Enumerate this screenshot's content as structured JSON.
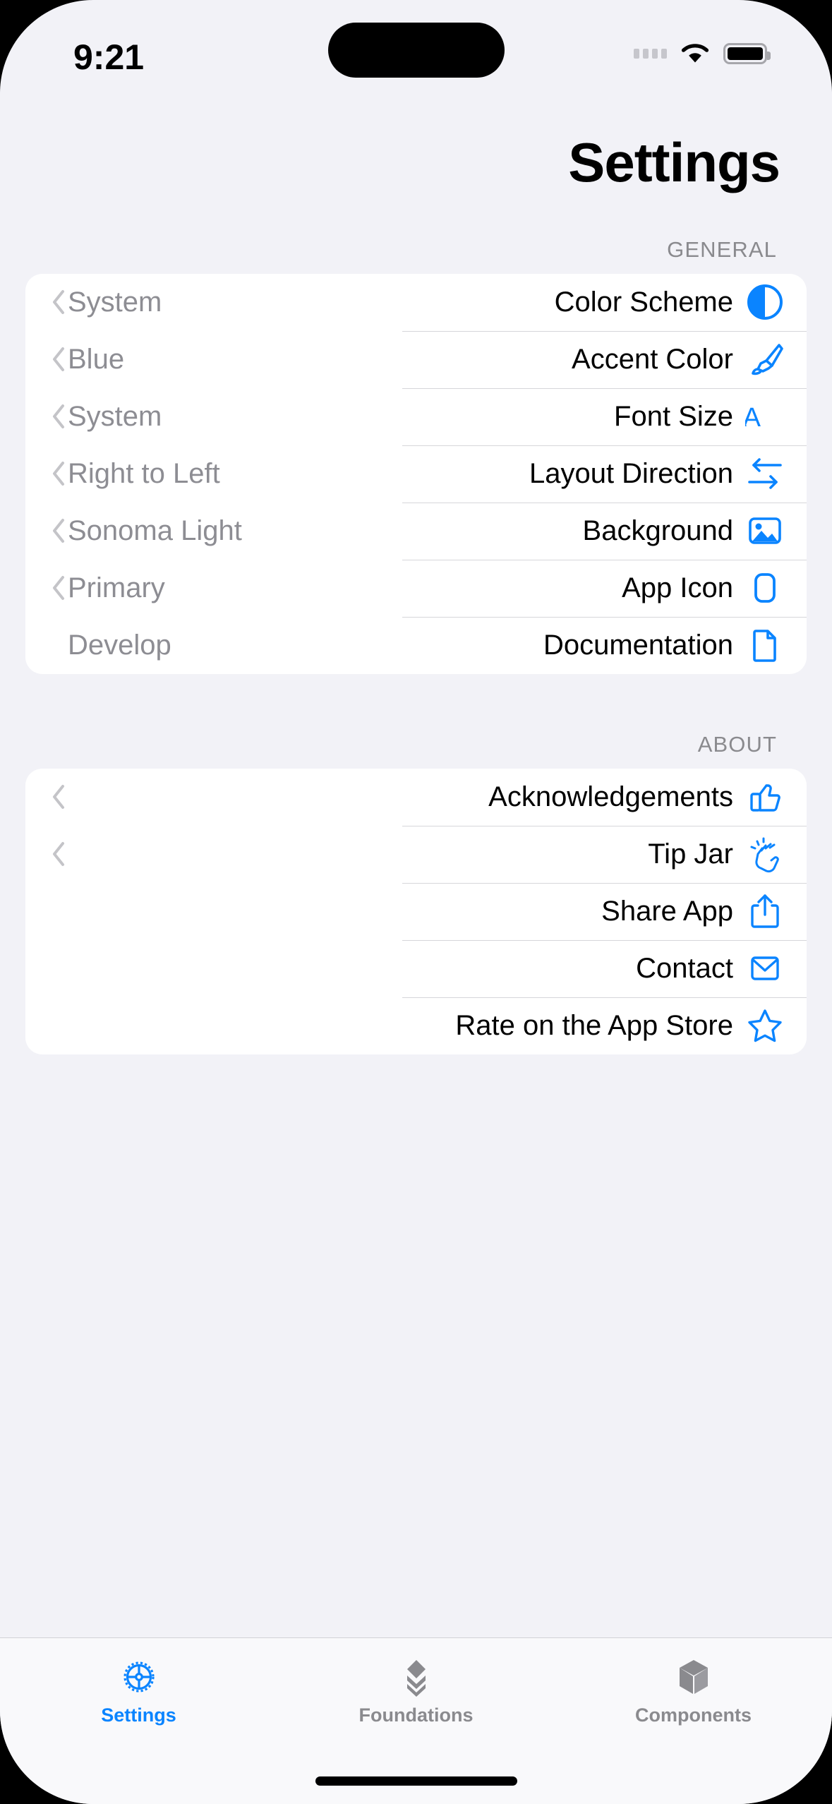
{
  "status_bar": {
    "time": "9:21",
    "signal_icon": "signal-dots-icon",
    "wifi_icon": "wifi-icon",
    "battery_icon": "battery-icon"
  },
  "header": {
    "title": "Settings"
  },
  "sections": [
    {
      "header": "GENERAL",
      "rows": [
        {
          "title": "Color Scheme",
          "value": "System",
          "icon": "circle-half-filled-icon",
          "has_chevron": true
        },
        {
          "title": "Accent Color",
          "value": "Blue",
          "icon": "paintbrush-icon",
          "has_chevron": true
        },
        {
          "title": "Font Size",
          "value": "System",
          "icon": "text-size-aa-icon",
          "has_chevron": true
        },
        {
          "title": "Layout Direction",
          "value": "Right to Left",
          "icon": "arrows-left-right-icon",
          "has_chevron": true
        },
        {
          "title": "Background",
          "value": "Sonoma Light",
          "icon": "photo-icon",
          "has_chevron": true
        },
        {
          "title": "App Icon",
          "value": "Primary",
          "icon": "app-icon-rounded-rect",
          "has_chevron": true
        },
        {
          "title": "Documentation",
          "value": "Develop",
          "icon": "document-icon",
          "has_chevron": false
        }
      ]
    },
    {
      "header": "ABOUT",
      "rows": [
        {
          "title": "Acknowledgements",
          "value": "",
          "icon": "thumbs-up-icon",
          "has_chevron": true
        },
        {
          "title": "Tip Jar",
          "value": "",
          "icon": "clapping-hands-icon",
          "has_chevron": true
        },
        {
          "title": "Share App",
          "value": "",
          "icon": "share-icon",
          "has_chevron": false
        },
        {
          "title": "Contact",
          "value": "",
          "icon": "envelope-icon",
          "has_chevron": false
        },
        {
          "title": "Rate on the App Store",
          "value": "",
          "icon": "star-icon",
          "has_chevron": false
        }
      ]
    }
  ],
  "tab_bar": {
    "tabs": [
      {
        "label": "Settings",
        "icon": "gear-icon",
        "active": true
      },
      {
        "label": "Foundations",
        "icon": "stacked-chevrons-icon",
        "active": false
      },
      {
        "label": "Components",
        "icon": "cube-icon",
        "active": false
      }
    ]
  },
  "colors": {
    "accent": "#0a84ff",
    "background": "#f2f2f7",
    "card": "#ffffff",
    "secondary_text": "#8d8d93",
    "separator": "#d6d6da"
  }
}
